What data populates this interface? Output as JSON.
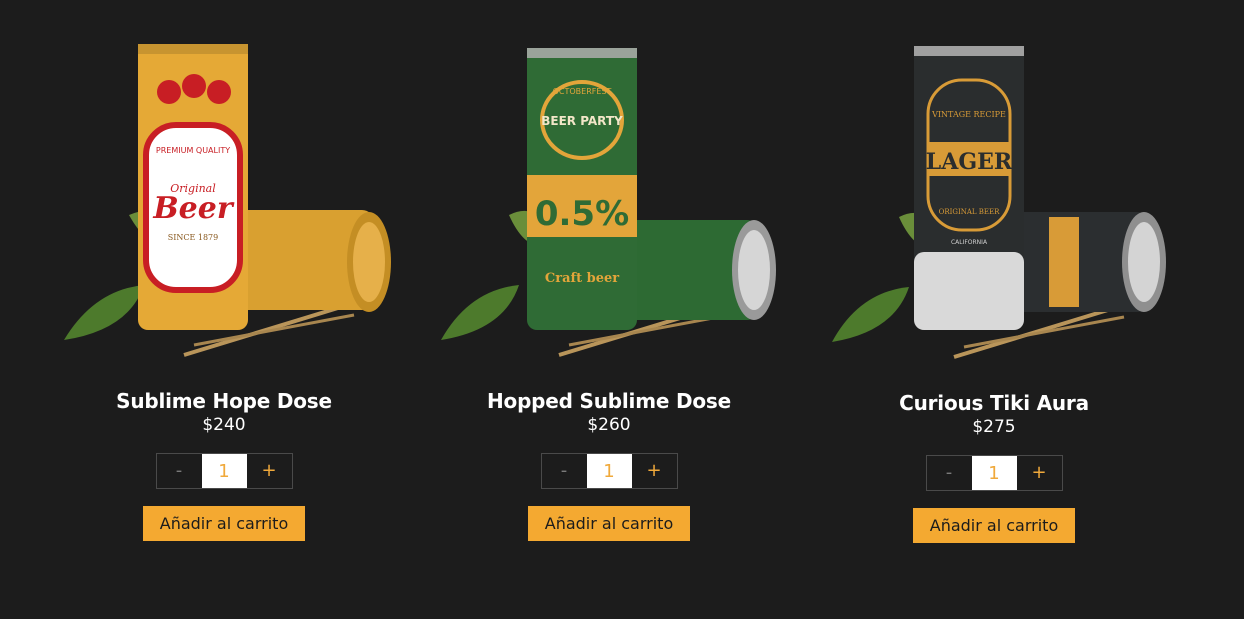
{
  "colors": {
    "background": "#1c1c1c",
    "accent": "#f4a931",
    "text": "#ffffff"
  },
  "products": [
    {
      "title": "Sublime Hope Dose",
      "price": "$240",
      "qty_minus": "-",
      "qty_value": "1",
      "qty_plus": "+",
      "add_label": "Añadir al carrito",
      "image_label": "Beer",
      "image_sublabel": "Original",
      "image_tag": "PREMIUM QUALITY",
      "image_since": "SINCE 1879",
      "can_color": "#e3a63a"
    },
    {
      "title": "Hopped Sublime Dose",
      "price": "$260",
      "qty_minus": "-",
      "qty_value": "1",
      "qty_plus": "+",
      "add_label": "Añadir al carrito",
      "image_label": "BEER PARTY",
      "image_sublabel": "OCTOBERFEST",
      "image_tag": "0.5%",
      "image_since": "Craft beer",
      "can_color": "#2f6b35"
    },
    {
      "title": "Curious Tiki Aura",
      "price": "$275",
      "qty_minus": "-",
      "qty_value": "1",
      "qty_plus": "+",
      "add_label": "Añadir al carrito",
      "image_label": "LAGER",
      "image_sublabel": "VINTAGE RECIPE",
      "image_tag": "ORIGINAL BEER",
      "image_since": "CALIFORNIA",
      "can_color": "#2a2d2e"
    }
  ]
}
